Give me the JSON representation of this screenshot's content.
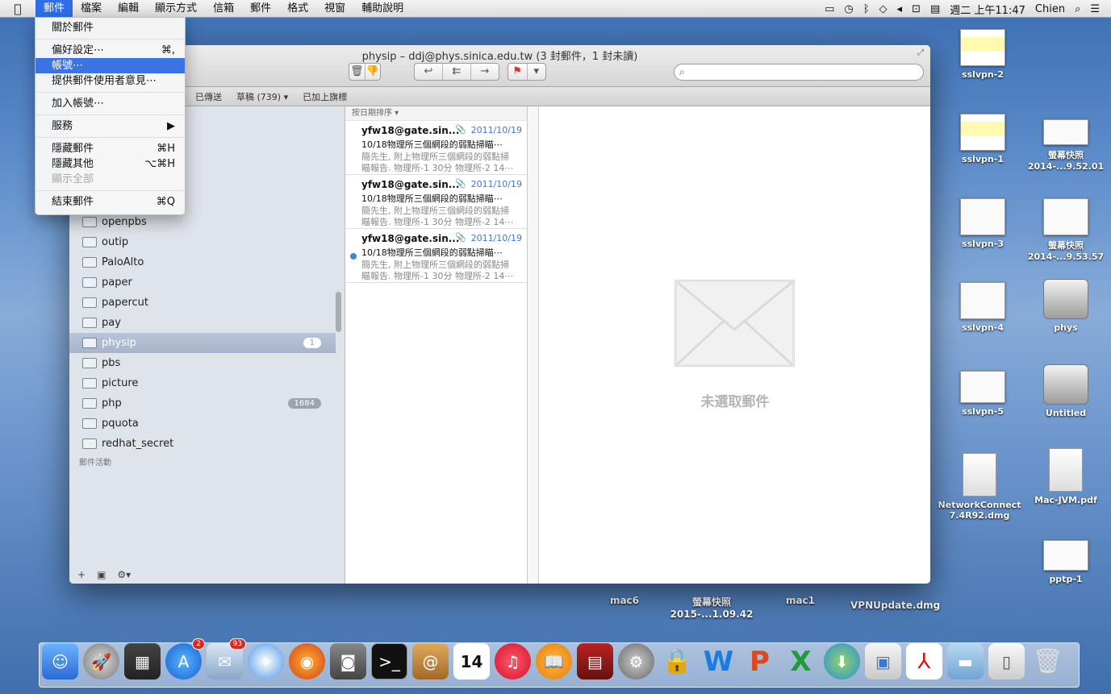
{
  "menubar": {
    "items": [
      "郵件",
      "檔案",
      "編輯",
      "顯示方式",
      "信箱",
      "郵件",
      "格式",
      "視窗",
      "輔助說明"
    ],
    "clock": "週二 上午11:47",
    "user": "Chien"
  },
  "app_menu": {
    "items": [
      "關於郵件",
      "偏好設定⋯",
      "帳號⋯",
      "提供郵件使用者意見⋯",
      "加入帳號⋯",
      "服務",
      "隱藏郵件",
      "隱藏其他",
      "顯示全部",
      "結束郵件"
    ],
    "shortcuts": {
      "prefs": "⌘,",
      "hide": "⌘H",
      "hide_others": "⌥⌘H",
      "quit": "⌘Q"
    }
  },
  "window": {
    "title": "physip – ddj@phys.sinica.edu.tw (3 封郵件，1 封未讀)"
  },
  "favorites": [
    "已傳送",
    "草稿 (739) ▾",
    "已加上旗標"
  ],
  "sidebar": {
    "items": [
      {
        "name": "openpbs",
        "badge": ""
      },
      {
        "name": "outip",
        "badge": ""
      },
      {
        "name": "PaloAlto",
        "badge": ""
      },
      {
        "name": "paper",
        "badge": ""
      },
      {
        "name": "papercut",
        "badge": ""
      },
      {
        "name": "pay",
        "badge": ""
      },
      {
        "name": "physip",
        "badge": "1"
      },
      {
        "name": "pbs",
        "badge": ""
      },
      {
        "name": "picture",
        "badge": ""
      },
      {
        "name": "php",
        "badge": "1684"
      },
      {
        "name": "pquota",
        "badge": ""
      },
      {
        "name": "redhat_secret",
        "badge": ""
      }
    ],
    "activity": "郵件活動"
  },
  "messages": {
    "sort": "按日期排序 ▾",
    "items": [
      {
        "from": "yfw18@gate.sin...",
        "date": "2011/10/19",
        "subject": "10/18物理所三個網段的弱點掃瞄⋯",
        "preview1": "簡先生, 附上物理所三個網段的弱點掃",
        "preview2": "瞄報告. 物理所-1 30分 物理所-2 14⋯"
      },
      {
        "from": "yfw18@gate.sin...",
        "date": "2011/10/19",
        "subject": "10/18物理所三個網段的弱點掃瞄⋯",
        "preview1": "簡先生, 附上物理所三個網段的弱點掃",
        "preview2": "瞄報告. 物理所-1 30分 物理所-2 14⋯"
      },
      {
        "from": "yfw18@gate.sin...",
        "date": "2011/10/19",
        "subject": "10/18物理所三個網段的弱點掃瞄⋯",
        "preview1": "簡先生, 附上物理所三個網段的弱點掃",
        "preview2": "瞄報告. 物理所-1 30分 物理所-2 14⋯"
      }
    ]
  },
  "viewer": {
    "empty": "未選取郵件"
  },
  "desktop": {
    "icons": [
      "sslvpn-2",
      "sslvpn-1",
      "螢幕快照\n2014-...9.52.01",
      "sslvpn-3",
      "螢幕快照\n2014-...9.53.57",
      "sslvpn-4",
      "phys",
      "sslvpn-5",
      "Untitled",
      "NetworkConnect\n7.4R92.dmg",
      "Mac-JVM.pdf",
      "pptp-1"
    ],
    "behind": [
      "mac6",
      "螢幕快照\n2015-...1.09.42",
      "mac1",
      "VPNUpdate.dmg"
    ]
  },
  "dock": {
    "badges": [
      "2",
      "93"
    ],
    "calendar_day": "14"
  },
  "colors": {
    "accent": "#2f6ee6",
    "unread": "#4a7fd7",
    "date": "#3a78d8"
  }
}
